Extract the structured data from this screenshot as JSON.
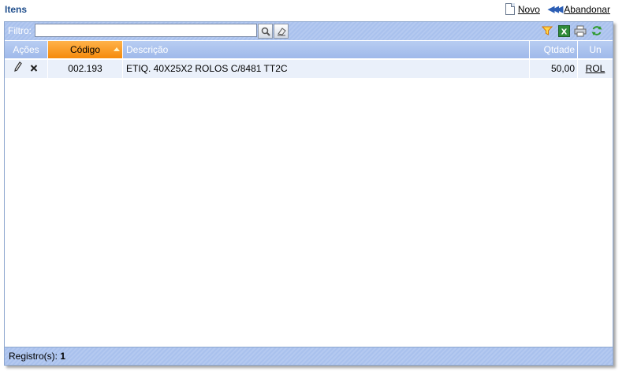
{
  "header": {
    "title": "Itens"
  },
  "toplinks": {
    "novo": "Novo",
    "abandonar": "Abandonar"
  },
  "filter": {
    "label": "Filtro:",
    "value": ""
  },
  "table": {
    "headers": {
      "acoes": "Ações",
      "codigo": "Código",
      "descricao": "Descrição",
      "qtdade": "Qtdade",
      "un": "Un"
    },
    "rows": [
      {
        "codigo": "002.193",
        "descricao": "ETIQ. 40X25X2 ROLOS C/8481 TT2C",
        "qtdade": "50,00",
        "un": "ROL"
      }
    ]
  },
  "footer": {
    "label": "Registro(s):",
    "count": "1"
  },
  "colors": {
    "accent": "#a9c1ed",
    "sorted": "#f58a0b",
    "title": "#1f4e8c"
  }
}
